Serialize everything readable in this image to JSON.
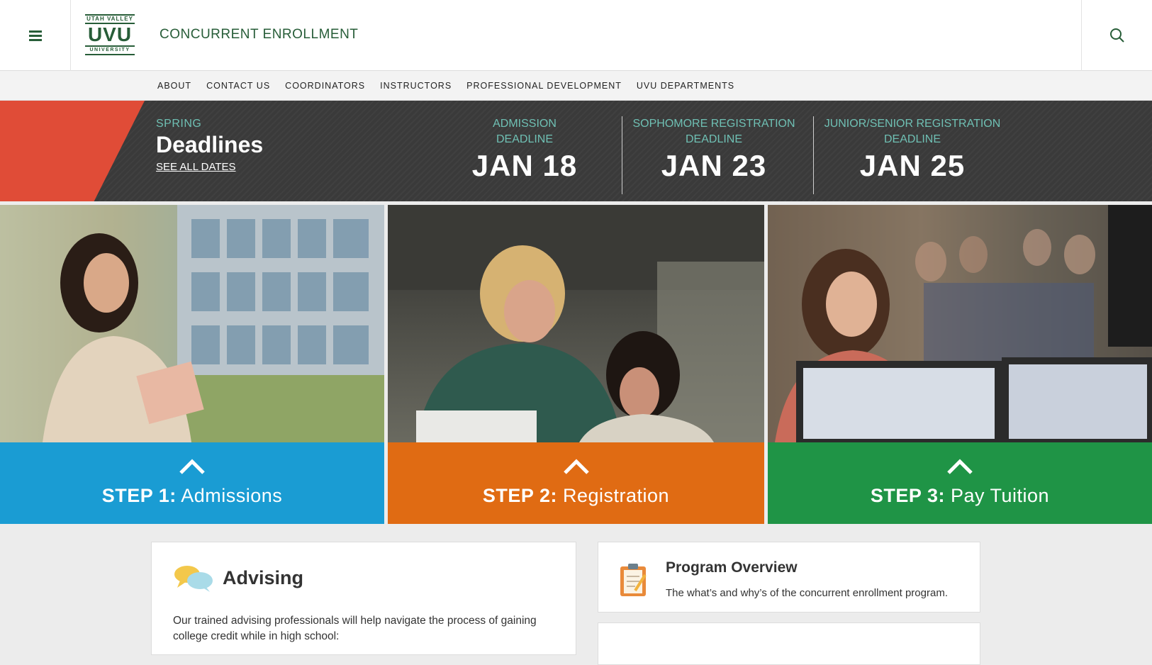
{
  "header": {
    "logo_top": "UTAH VALLEY",
    "logo_main": "UVU",
    "logo_bottom": "UNIVERSITY",
    "site_title": "CONCURRENT ENROLLMENT"
  },
  "subnav": {
    "items": [
      "ABOUT",
      "CONTACT US",
      "COORDINATORS",
      "INSTRUCTORS",
      "PROFESSIONAL DEVELOPMENT",
      "UVU DEPARTMENTS"
    ]
  },
  "deadlines": {
    "season": "SPRING",
    "title": "Deadlines",
    "see_all": "SEE ALL DATES",
    "items": [
      {
        "label_1": "ADMISSION",
        "label_2": "DEADLINE",
        "date": "JAN 18"
      },
      {
        "label_1": "SOPHOMORE REGISTRATION",
        "label_2": "DEADLINE",
        "date": "JAN 23"
      },
      {
        "label_1": "JUNIOR/SENIOR REGISTRATION",
        "label_2": "DEADLINE",
        "date": "JAN 25"
      }
    ]
  },
  "steps": [
    {
      "step": "STEP 1:",
      "name": "Admissions",
      "color": "#1a9cd3"
    },
    {
      "step": "STEP 2:",
      "name": "Registration",
      "color": "#e06b13"
    },
    {
      "step": "STEP 3:",
      "name": "Pay Tuition",
      "color": "#1f9446"
    }
  ],
  "advising": {
    "title": "Advising",
    "body": "Our trained advising professionals will help navigate the process of gaining college credit while in high school:"
  },
  "overview": {
    "title": "Program Overview",
    "body": "The what’s and why’s of the concurrent enrollment program."
  },
  "colors": {
    "brand_green": "#275d38",
    "accent_red": "#e04c37",
    "teal_label": "#6fc0b4"
  },
  "icons": [
    "menu-icon",
    "search-icon",
    "chevron-up-icon",
    "chat-bubbles-icon",
    "clipboard-icon"
  ]
}
